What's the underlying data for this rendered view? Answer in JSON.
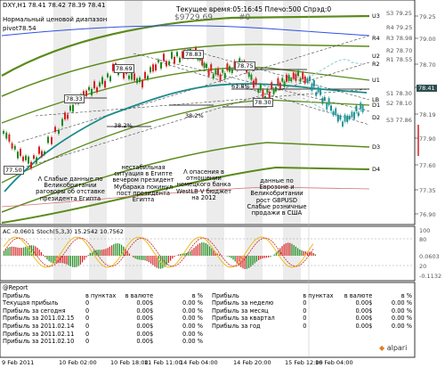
{
  "header": {
    "symbol_line": "DXY,H1  78.41 78.42 78.39 78.41",
    "channel_title": "Нормальный ценовой диапазон",
    "pivot_label": "pivot78.54",
    "time_line": "Текущее время:05:16:45 Плечо:500 Спрэд:0",
    "price_big": "$9729.69",
    "count_big": "#0"
  },
  "price_axis": {
    "current_price": "78.41",
    "ticks": [
      "79.25",
      "79.00",
      "78.70",
      "78.47",
      "78.19",
      "77.90",
      "77.60",
      "77.35",
      "77.05",
      "76.90"
    ]
  },
  "levels": [
    {
      "name": "U3",
      "price": "S3 79.25"
    },
    {
      "name": "R4",
      "price": "R4 79.25"
    },
    {
      "name": "U2",
      "price": "R3 78.98"
    },
    {
      "name": "R2",
      "price": "R2 78.70"
    },
    {
      "name": "U1",
      "price": "R1 78.55"
    },
    {
      "name": "LB",
      "price": "S1 78.30"
    },
    {
      "name": "D1",
      "price": "S2 78.10"
    },
    {
      "name": "D2",
      "price": "S3 77.86"
    },
    {
      "name": "D3",
      "price": ""
    },
    {
      "name": "D4",
      "price": ""
    }
  ],
  "price_labels": [
    {
      "text": "78.33"
    },
    {
      "text": "78.69"
    },
    {
      "text": "78.83"
    },
    {
      "text": "78.75"
    },
    {
      "text": "78.30"
    },
    {
      "text": "77.50"
    }
  ],
  "fib_labels": [
    {
      "text": "38.2%"
    },
    {
      "text": "38.2%"
    },
    {
      "text": "61.8%"
    }
  ],
  "annotations": [
    {
      "text": "Λ Слабые данные по Великобритании раговоры об отставке президента Египта"
    },
    {
      "text": "нестабильная ситуация в Египте вечером президент Мубарака покинул пост президента Египта"
    },
    {
      "text": "Λ опасения в отношении немецкого банка WestLB V бюджет на 2012"
    },
    {
      "text": "данные по Еврозоне и Великобритании рост GBPUSD Слабые розничные продажи в США"
    }
  ],
  "indicator": {
    "label": "AC -0.0601  Stoch(5,3,3) 15.2542 10.7562",
    "axis": [
      "100",
      "80",
      "20",
      "0.0603",
      "-0.1132"
    ]
  },
  "report": {
    "title": "@Report",
    "headers": [
      "Прибыль",
      "в пунктах",
      "в валюте",
      "в %",
      "Прибыль",
      "в пунктах",
      "в валюте",
      "в %"
    ],
    "rows": [
      [
        "Текущая прибыль",
        "0",
        "0.00$",
        "0.00 %",
        "Прибыль за неделю",
        "0",
        "0.00$",
        "0.00 %"
      ],
      [
        "Прибыль за сегодня",
        "0",
        "0.00$",
        "0.00 %",
        "Прибыль за месяц",
        "0",
        "0.00$",
        "0.00 %"
      ],
      [
        "Прибыль за 2011.02.15",
        "0",
        "0.00$",
        "0.00 %",
        "Прибыль за квартал",
        "0",
        "0.00$",
        "0.00 %"
      ],
      [
        "Прибыль за 2011.02.14",
        "0",
        "0.00$",
        "0.00 %",
        "Прибыль за год",
        "0",
        "0.00$",
        "0.00 %"
      ],
      [
        "Прибыль за 2011.02.11",
        "0",
        "0.00$",
        "0.00 %",
        "",
        "",
        "",
        ""
      ],
      [
        "Прибыль за 2011.02.10",
        "0",
        "0.00$",
        "0.00 %",
        "",
        "",
        "",
        ""
      ]
    ],
    "logo": "alpari"
  },
  "x_axis": [
    "9 Feb 2011",
    "10 Feb 02:00",
    "10 Feb 18:00",
    "11 Feb 11:00",
    "14 Feb 04:00",
    "14 Feb 20:00",
    "15 Feb 12:00",
    "16 Feb 04:00"
  ],
  "colors": {
    "bull": "#1a8a1a",
    "bear": "#d42020",
    "channel": "#5a8a1a",
    "ma": "#1a8a8a",
    "blue": "#3050e0"
  }
}
